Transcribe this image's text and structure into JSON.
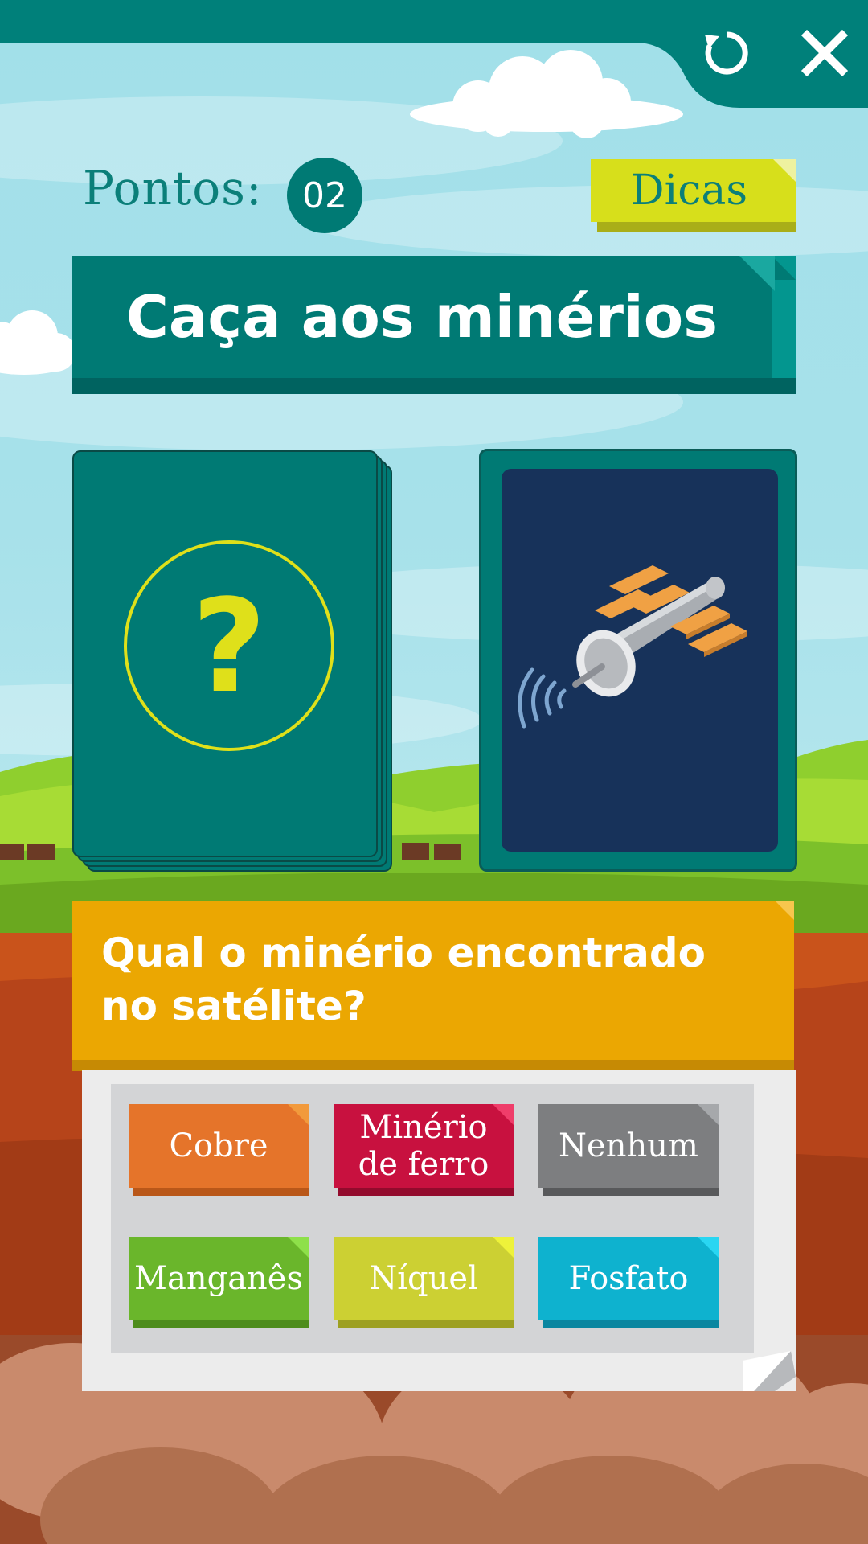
{
  "header": {
    "score_label": "Pontos:",
    "score_value": "02",
    "hints_label": "Dicas",
    "reload_icon": "reload-icon",
    "close_icon": "close-icon"
  },
  "game": {
    "title": "Caça aos minérios",
    "mystery_card_symbol": "?",
    "image_card_icon": "satellite-icon",
    "question": "Qual o minério encontrado no satélite?"
  },
  "answers": [
    {
      "label": "Cobre",
      "color": "#e5742a"
    },
    {
      "label": "Minério de ferro",
      "color": "#c8113f"
    },
    {
      "label": "Nenhum",
      "color": "#7d7e80"
    },
    {
      "label": "Manganês",
      "color": "#6ab62b"
    },
    {
      "label": "Níquel",
      "color": "#ccd033"
    },
    {
      "label": "Fosfato",
      "color": "#0eb2cf"
    }
  ],
  "colors": {
    "primary_teal": "#007a74",
    "hints_yellow": "#d7df1b",
    "question_orange": "#eba702"
  }
}
